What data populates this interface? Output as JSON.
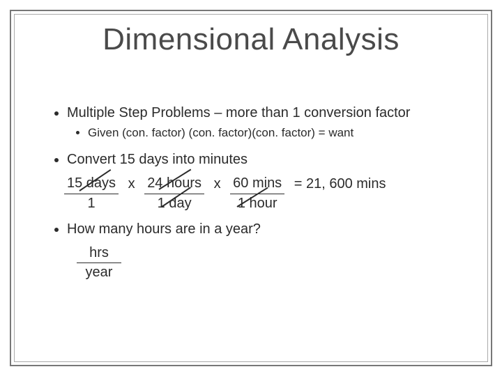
{
  "title": "Dimensional Analysis",
  "bullets": {
    "b1": "Multiple Step Problems – more than 1 conversion factor",
    "b1a": "Given (con. factor) (con. factor)(con. factor) = want",
    "b2": "Convert 15 days into minutes",
    "b3": "How many hours are in a year?"
  },
  "calc": {
    "f1n": "15 days",
    "f1d": "1",
    "x1": "x",
    "f2n": "24 hours",
    "f2d": "1 day",
    "x2": "x",
    "f3n": "60 mins",
    "f3d": "1 hour",
    "eq": "= 21, 600 mins"
  },
  "q2": {
    "num": "hrs",
    "den": "year"
  }
}
